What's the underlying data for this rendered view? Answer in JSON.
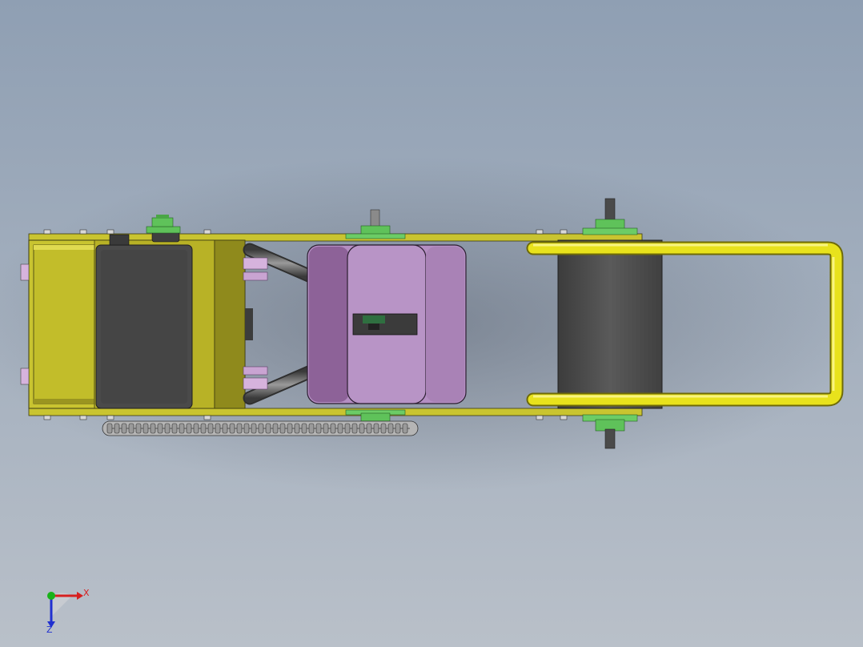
{
  "scene": {
    "background_top": "#8f9fb3",
    "background_bottom": "#b9c0c9",
    "colors": {
      "frame_yellow": "#c9c430",
      "frame_yellow_dark": "#8f8a1c",
      "handle_yellow": "#e8e21c",
      "motor_gray": "#4a4a4a",
      "drum_gray": "#555555",
      "gearbox_pink": "#b48ec2",
      "gearbox_pink_dark": "#8d6298",
      "sprocket_green": "#5fc25a",
      "shaft_gray": "#6f6f6f",
      "chain_gray": "#9a9a9a"
    }
  },
  "triad": {
    "x_label": "X",
    "z_label": "Z",
    "x_color": "#d62020",
    "y_color": "#19b219",
    "z_color": "#2030d0"
  }
}
